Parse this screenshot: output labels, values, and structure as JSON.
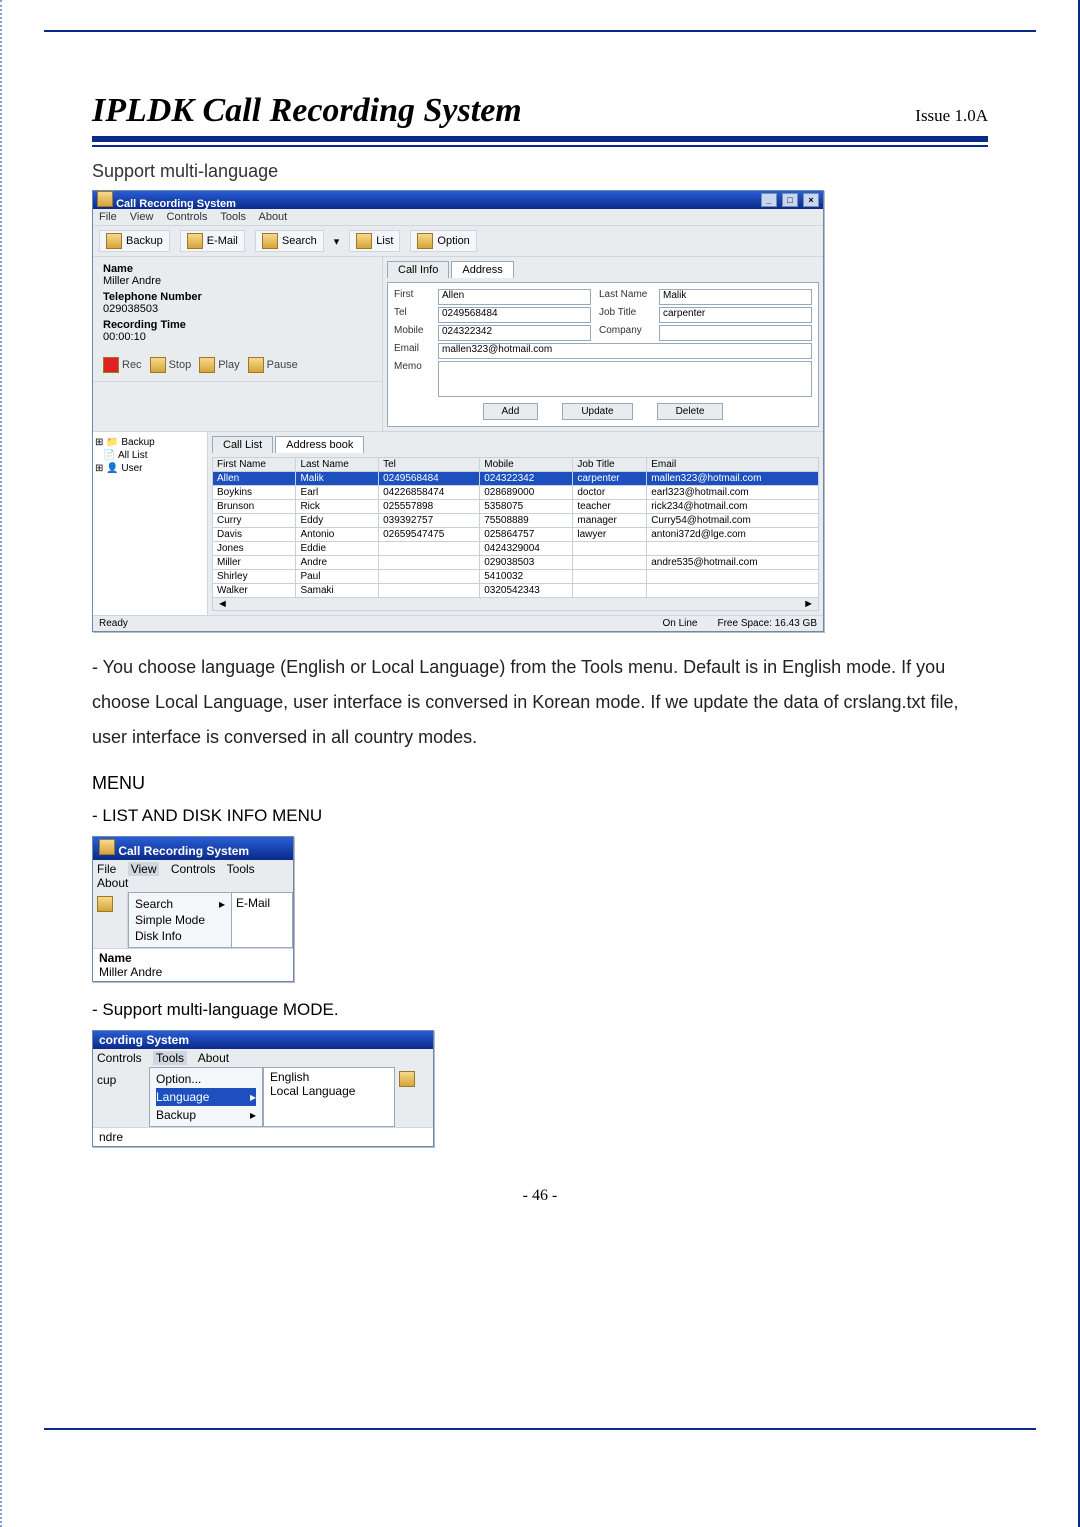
{
  "doc": {
    "title": "IPLDK Call Recording System",
    "issue": "Issue 1.0A",
    "section": "Support multi-language",
    "page_number": "- 46 -"
  },
  "main_window": {
    "title": "Call Recording System",
    "menubar": [
      "File",
      "View",
      "Controls",
      "Tools",
      "About"
    ],
    "toolbar": {
      "backup": "Backup",
      "email": "E-Mail",
      "search": "Search",
      "list": "List",
      "option": "Option"
    },
    "info": {
      "name_label": "Name",
      "name_value": "Miller Andre",
      "tel_label": "Telephone Number",
      "tel_value": "029038503",
      "rec_label": "Recording Time",
      "rec_value": "00:00:10"
    },
    "rec_controls": {
      "rec": "Rec",
      "stop": "Stop",
      "play": "Play",
      "pause": "Pause"
    },
    "right_tabs": {
      "call_info": "Call Info",
      "address": "Address"
    },
    "address_form": {
      "labels": {
        "first": "First",
        "lastname": "Last Name",
        "tel": "Tel",
        "jobtitle": "Job Title",
        "mobile": "Mobile",
        "company": "Company",
        "email": "Email",
        "memo": "Memo"
      },
      "values": {
        "first": "Allen",
        "lastname": "Malik",
        "tel": "0249568484",
        "jobtitle": "carpenter",
        "mobile": "024322342",
        "company": "",
        "email": "mallen323@hotmail.com",
        "memo": ""
      },
      "buttons": {
        "add": "Add",
        "update": "Update",
        "delete": "Delete"
      }
    },
    "tree": {
      "backup": "Backup",
      "all_list": "All List",
      "user": "User"
    },
    "grid_tabs": {
      "call_list": "Call List",
      "address_book": "Address book"
    },
    "grid_headers": [
      "First Name",
      "Last Name",
      "Tel",
      "Mobile",
      "Job Title",
      "Email"
    ],
    "grid_rows": [
      {
        "first": "Allen",
        "last": "Malik",
        "tel": "0249568484",
        "mobile": "024322342",
        "job": "carpenter",
        "email": "mallen323@hotmail.com",
        "selected": true
      },
      {
        "first": "Boykins",
        "last": "Earl",
        "tel": "04226858474",
        "mobile": "028689000",
        "job": "doctor",
        "email": "earl323@hotmail.com"
      },
      {
        "first": "Brunson",
        "last": "Rick",
        "tel": "025557898",
        "mobile": "5358075",
        "job": "teacher",
        "email": "rick234@hotmail.com"
      },
      {
        "first": "Curry",
        "last": "Eddy",
        "tel": "039392757",
        "mobile": "75508889",
        "job": "manager",
        "email": "Curry54@hotmail.com"
      },
      {
        "first": "Davis",
        "last": "Antonio",
        "tel": "02659547475",
        "mobile": "025864757",
        "job": "lawyer",
        "email": "antoni372d@lge.com"
      },
      {
        "first": "Jones",
        "last": "Eddie",
        "tel": "",
        "mobile": "0424329004",
        "job": "",
        "email": ""
      },
      {
        "first": "Miller",
        "last": "Andre",
        "tel": "",
        "mobile": "029038503",
        "job": "",
        "email": "andre535@hotmail.com"
      },
      {
        "first": "Shirley",
        "last": "Paul",
        "tel": "",
        "mobile": "5410032",
        "job": "",
        "email": ""
      },
      {
        "first": "Walker",
        "last": "Samaki",
        "tel": "",
        "mobile": "0320542343",
        "job": "",
        "email": ""
      }
    ],
    "status": {
      "ready": "Ready",
      "online": "On Line",
      "free_space": "Free Space: 16.43 GB"
    }
  },
  "body_text": "- You choose language (English or Local Language) from the Tools menu. Default is in English mode. If you choose Local Language, user interface is conversed in Korean mode. If we update the data of crslang.txt file, user interface is conversed in all country modes.",
  "menu_heading": "MENU",
  "list_disk_heading": "- LIST AND DISK INFO MENU",
  "mini1": {
    "title": "Call Recording System",
    "menubar": [
      "File",
      "View",
      "Controls",
      "Tools",
      "About"
    ],
    "dropdown": [
      "Search",
      "Simple Mode",
      "Disk Info"
    ],
    "side": "E-Mail",
    "below_name_label": "Name",
    "below_name_value": "Miller Andre"
  },
  "support_mode_heading": "- Support multi-language MODE.",
  "mini2": {
    "title_fragment": "cording System",
    "menubar": [
      "Controls",
      "Tools",
      "About"
    ],
    "left_label": "cup",
    "tools_items": {
      "option": "Option...",
      "language": "Language",
      "backup": "Backup"
    },
    "lang_items": {
      "english": "English",
      "local": "Local Language"
    },
    "below": "ndre"
  }
}
